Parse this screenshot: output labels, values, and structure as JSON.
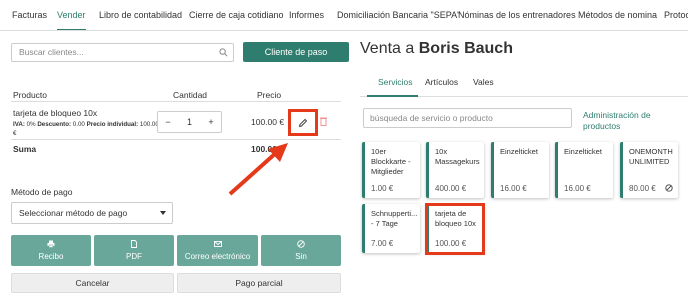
{
  "nav": {
    "tabs": [
      "Facturas",
      "Vender",
      "Libro de contabilidad",
      "Cierre de caja cotidiano",
      "Informes",
      "Domiciliación Bancaria \"SEPA\"",
      "Nóminas de los entrenadores",
      "Métodos de nomina",
      "Protoc"
    ],
    "active": "Vender"
  },
  "left": {
    "search_placeholder": "Buscar clientes...",
    "guest_button": "Cliente de paso",
    "cart": {
      "col_product": "Producto",
      "col_quantity": "Cantidad",
      "col_price": "Precio",
      "item": {
        "name": "tarjeta de bloqueo 10x",
        "iva_label": "IVA:",
        "iva": "0%",
        "discount_label": "Descuento:",
        "discount": "0.00",
        "unit_price_label": "Precio individual:",
        "unit_price": "100.00 €",
        "quantity": "1",
        "price": "100.00 €",
        "minus": "−",
        "plus": "+"
      },
      "sum_label": "Suma",
      "sum_value": "100.00 €"
    },
    "payment": {
      "label": "Método de pago",
      "select_value": "Seleccionar método de pago",
      "buttons": [
        "Recibo",
        "PDF",
        "Correo electrónico",
        "Sin"
      ],
      "cancel": "Cancelar",
      "partial": "Pago parcial"
    }
  },
  "right": {
    "title_prefix": "Venta a",
    "customer": "Boris Bauch",
    "tabs": [
      "Servicios",
      "Artículos",
      "Vales"
    ],
    "active_tab": "Servicios",
    "search_placeholder": "búsqueda de servicio o producto",
    "admin_link": "Administración de productos",
    "tiles": [
      {
        "name": "10er Blockkarte - Mitglieder",
        "price": "1.00 €",
        "icon": ""
      },
      {
        "name": "10x Massagekurs",
        "price": "400.00 €",
        "icon": ""
      },
      {
        "name": "Einzelticket",
        "price": "16.00 €",
        "icon": ""
      },
      {
        "name": "Einzelticket",
        "price": "16.00 €",
        "icon": ""
      },
      {
        "name": "ONEMONTH UNLIMITED",
        "price": "80.00 €",
        "icon": "ban-icon"
      },
      {
        "name": "Schnupperti... - 7 Tage",
        "price": "7.00 €",
        "icon": ""
      },
      {
        "name": "tarjeta de bloqueo 10x",
        "price": "100.00 €",
        "icon": ""
      }
    ]
  },
  "colors": {
    "accent": "#2e7d6e",
    "button_muted": "#6aa79b",
    "highlight": "#e53a1a"
  }
}
